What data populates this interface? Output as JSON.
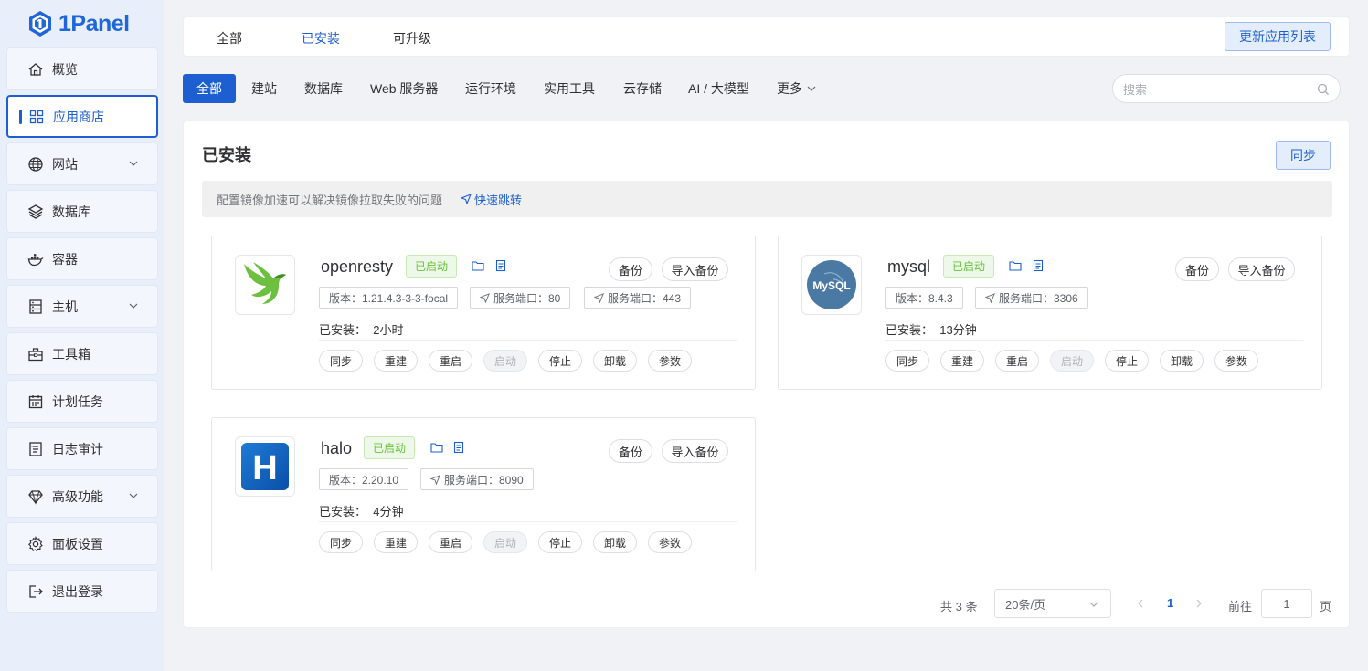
{
  "brand": {
    "logo_text": "1Panel"
  },
  "sidebar": {
    "items": [
      {
        "label": "概览",
        "icon": "home-icon"
      },
      {
        "label": "应用商店",
        "icon": "apps-grid-icon",
        "active": true
      },
      {
        "label": "网站",
        "icon": "globe-icon",
        "expandable": true
      },
      {
        "label": "数据库",
        "icon": "layers-icon"
      },
      {
        "label": "容器",
        "icon": "docker-icon"
      },
      {
        "label": "主机",
        "icon": "server-icon",
        "expandable": true
      },
      {
        "label": "工具箱",
        "icon": "toolbox-icon"
      },
      {
        "label": "计划任务",
        "icon": "calendar-icon"
      },
      {
        "label": "日志审计",
        "icon": "log-icon"
      },
      {
        "label": "高级功能",
        "icon": "diamond-icon",
        "expandable": true
      },
      {
        "label": "面板设置",
        "icon": "gear-icon"
      },
      {
        "label": "退出登录",
        "icon": "logout-icon"
      }
    ]
  },
  "topbar": {
    "tabs": [
      "全部",
      "已安装",
      "可升级"
    ],
    "selected_tab": "已安装",
    "update_button": "更新应用列表"
  },
  "categories": {
    "items": [
      "全部",
      "建站",
      "数据库",
      "Web 服务器",
      "运行环境",
      "实用工具",
      "云存储",
      "AI / 大模型",
      "更多"
    ],
    "selected": "全部"
  },
  "search": {
    "placeholder": "搜索"
  },
  "panel": {
    "title": "已安装",
    "sync_button": "同步",
    "notice_text": "配置镜像加速可以解决镜像拉取失败的问题",
    "notice_link": "快速跳转"
  },
  "apps": [
    {
      "name": "openresty",
      "status": "已启动",
      "tags": [
        "版本：1.21.4.3-3-3-focal",
        "服务端口：80",
        "服务端口：443"
      ],
      "installed_label": "已安装：",
      "installed_time": "2小时",
      "backup": "备份",
      "import_backup": "导入备份"
    },
    {
      "name": "mysql",
      "status": "已启动",
      "tags": [
        "版本：8.4.3",
        "服务端口：3306"
      ],
      "installed_label": "已安装：",
      "installed_time": "13分钟",
      "backup": "备份",
      "import_backup": "导入备份"
    },
    {
      "name": "halo",
      "status": "已启动",
      "tags": [
        "版本：2.20.10",
        "服务端口：8090"
      ],
      "installed_label": "已安装：",
      "installed_time": "4分钟",
      "backup": "备份",
      "import_backup": "导入备份"
    }
  ],
  "actions": [
    "同步",
    "重建",
    "重启",
    "启动",
    "停止",
    "卸载",
    "参数"
  ],
  "disabled_action": "启动",
  "mysql_logo_text": "MySQL",
  "halo_logo_letter": "H",
  "pagination": {
    "total": "共 3 条",
    "page_size": "20条/页",
    "current_page": "1",
    "goto_label": "前往",
    "goto_value": "1",
    "page_suffix": "页"
  },
  "colors": {
    "primary": "#1d5fd0",
    "success": "#67c23a",
    "sidebar_bg": "#e8effb"
  }
}
